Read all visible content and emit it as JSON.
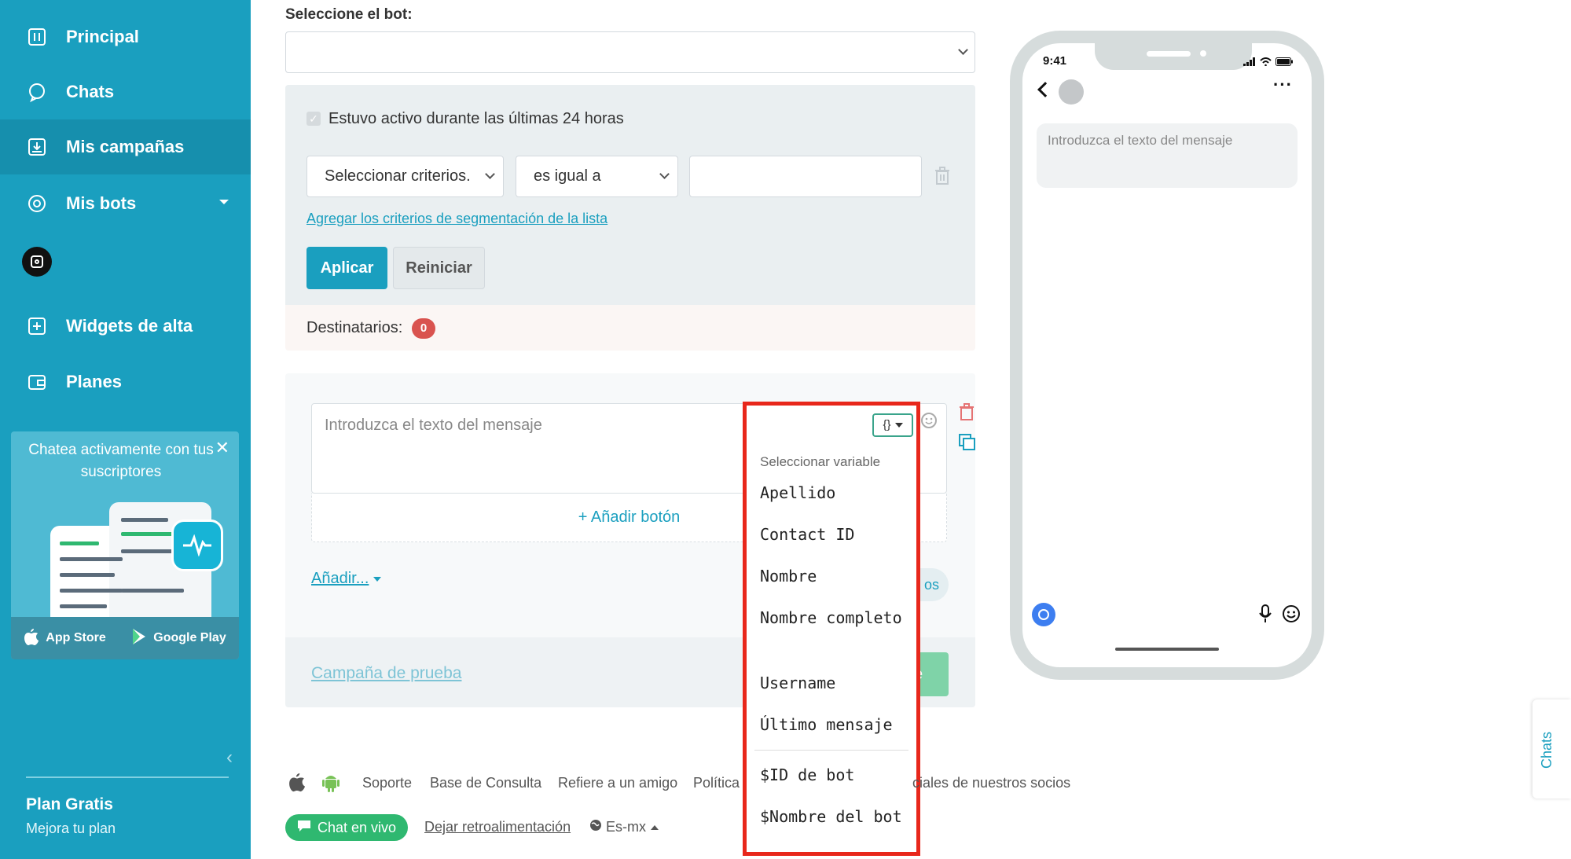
{
  "sidebar": {
    "items": [
      {
        "label": "Principal",
        "icon": "dashboard-icon"
      },
      {
        "label": "Chats",
        "icon": "chat-bubble-icon"
      },
      {
        "label": "Mis campañas",
        "icon": "campaign-icon"
      },
      {
        "label": "Mis bots",
        "icon": "bot-icon"
      },
      {
        "label": "Widgets de alta",
        "icon": "widget-icon"
      },
      {
        "label": "Planes",
        "icon": "wallet-icon"
      }
    ],
    "active": "Mis campañas",
    "promo": {
      "text": "Chatea activamente con tus suscriptores",
      "app_store": "App Store",
      "google_play": "Google Play"
    },
    "plan_title": "Plan Gratis",
    "plan_sub": "Mejora tu plan"
  },
  "form": {
    "bot_label": "Seleccione el bot:",
    "bot_value": "",
    "active_24h": "Estuvo activo durante las últimas 24 horas",
    "criteria_select": "Seleccionar criterios.",
    "operator_select": "es igual a",
    "criteria_value": "",
    "segment_link": "Agregar los criterios de segmentación de la lista",
    "apply": "Aplicar",
    "reset": "Reiniciar",
    "recipients_label": "Destinatarios:",
    "recipients_count": "0"
  },
  "message": {
    "placeholder": "Introduzca el texto del mensaje",
    "add_button": "+ Añadir botón",
    "add_menu": "Añadir...",
    "hidden_pill": "os",
    "test_campaign": "Campaña de prueba",
    "send_hidden": "e"
  },
  "variable_dropdown": {
    "toggle": "{}",
    "header": "Seleccionar variable",
    "items": [
      "Apellido",
      "Contact ID",
      "Nombre",
      "Nombre completo",
      "Username",
      "Último mensaje"
    ],
    "bot_items": [
      "$ID de bot",
      "$Nombre del bot"
    ]
  },
  "phone": {
    "time": "9:41",
    "bubble": "Introduzca el texto del mensaje"
  },
  "footer": {
    "links": [
      "Soporte",
      "Base de Consulta",
      "Refiere a un amigo",
      "Política",
      "ciales de nuestros socios"
    ],
    "live_chat": "Chat en vivo",
    "feedback": "Dejar retroalimentación",
    "language": "Es-mx"
  },
  "side_tab": "Chats",
  "colors": {
    "brand": "#1a9fbf",
    "danger": "#d9534f",
    "highlight": "#e8271b",
    "success": "#2fb870"
  }
}
